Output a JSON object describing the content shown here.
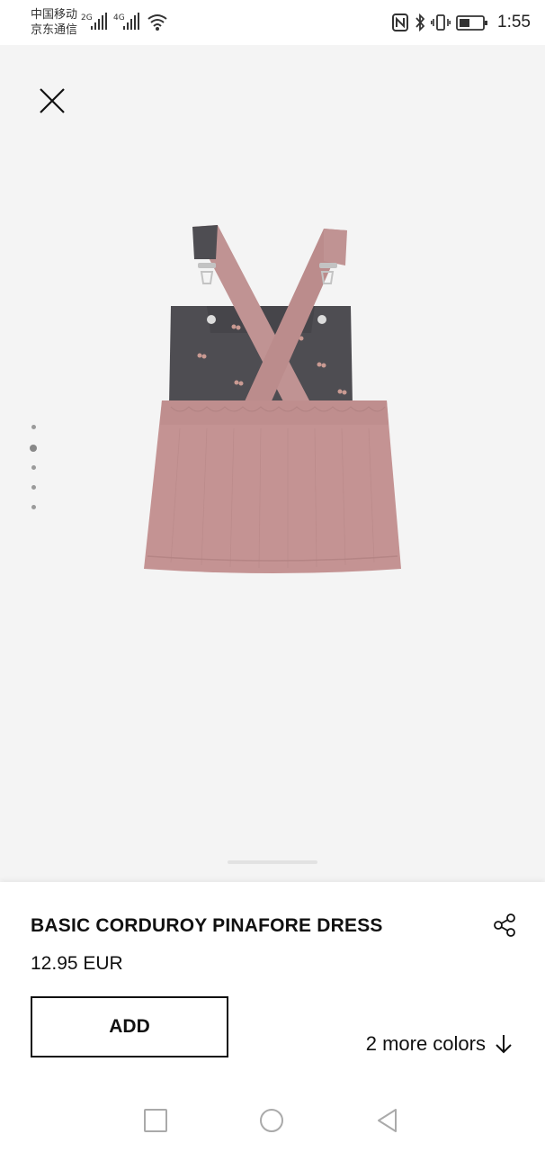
{
  "status_bar": {
    "carrier_line1": "中国移动",
    "carrier_line2": "京东通信",
    "network1": "2G",
    "network2": "4G",
    "time": "1:55"
  },
  "gallery": {
    "image_count": 5,
    "active_image": 2
  },
  "product": {
    "title": "BASIC CORDUROY PINAFORE DRESS",
    "price": "12.95 EUR",
    "add_label": "ADD",
    "more_colors_label": "2 more colors"
  },
  "colors": {
    "skirt": "#c49393",
    "bodice": "#4e4d52",
    "gallery_bg": "#f4f4f4"
  },
  "icons": {
    "close": "close-icon",
    "share": "share-icon",
    "arrow": "arrow-down-icon",
    "nav_recent": "square-icon",
    "nav_home": "circle-icon",
    "nav_back": "triangle-back-icon"
  }
}
